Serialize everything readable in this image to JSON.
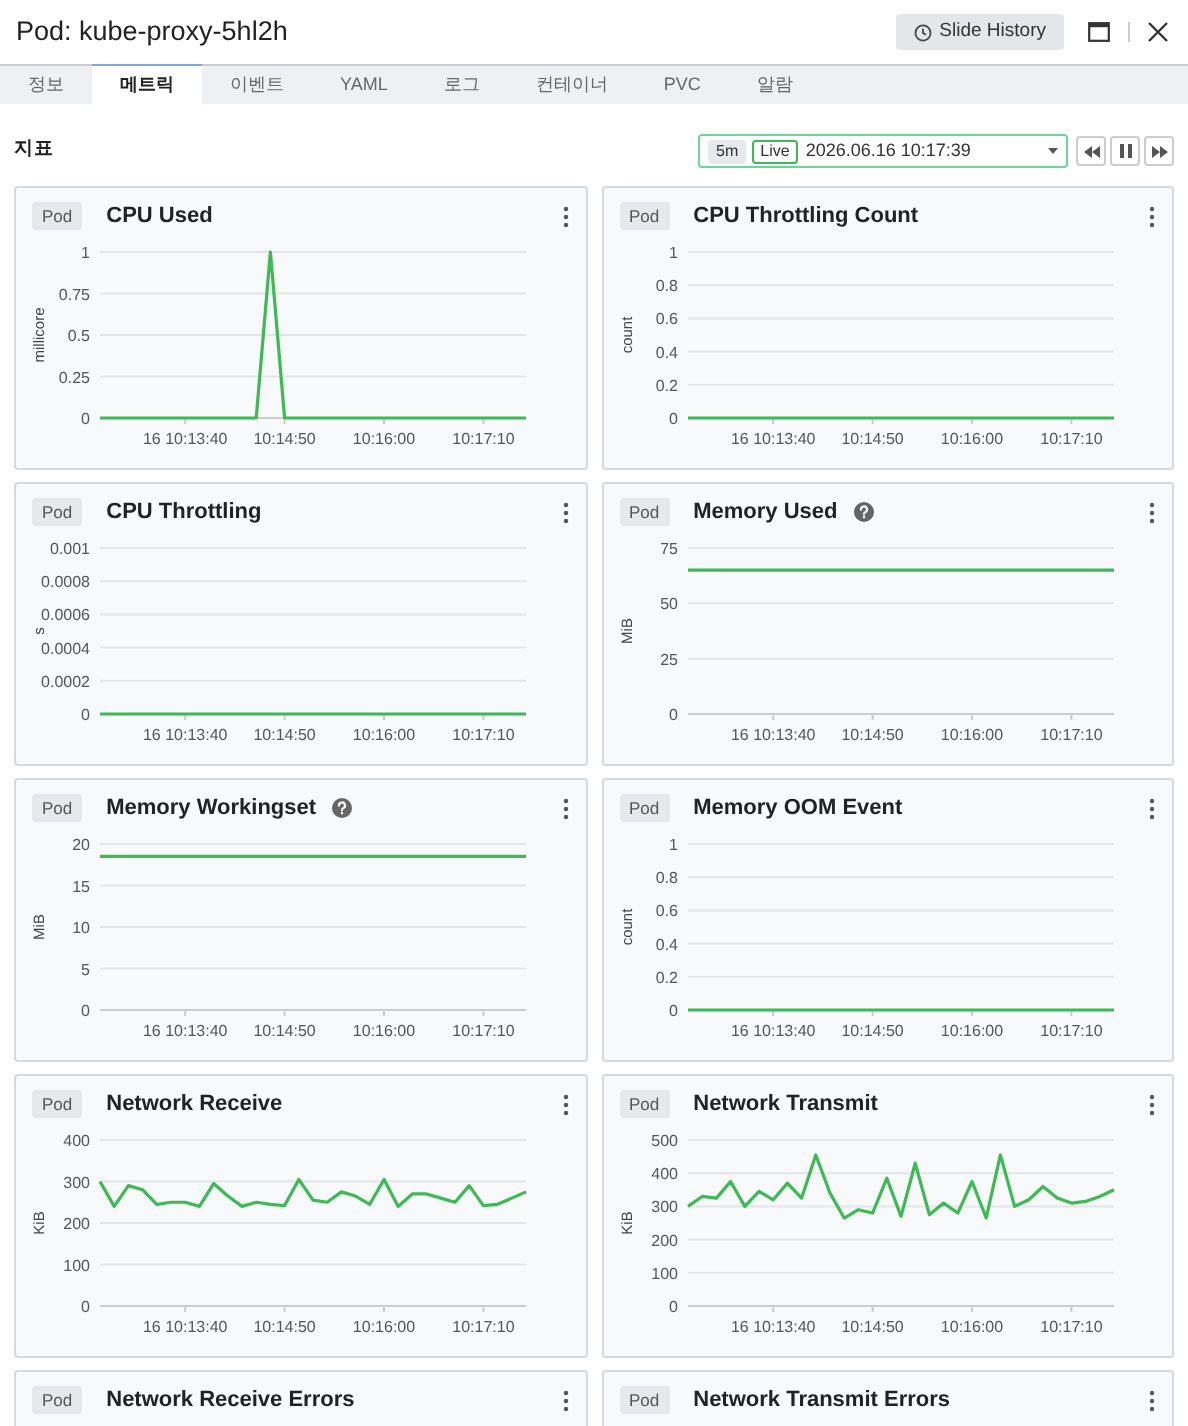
{
  "window": {
    "title": "Pod: kube-proxy-5hl2h",
    "history_button": "Slide History"
  },
  "tabs": [
    {
      "label": "정보",
      "selected": false
    },
    {
      "label": "메트릭",
      "selected": true
    },
    {
      "label": "이벤트",
      "selected": false
    },
    {
      "label": "YAML",
      "selected": false
    },
    {
      "label": "로그",
      "selected": false
    },
    {
      "label": "컨테이너",
      "selected": false
    },
    {
      "label": "PVC",
      "selected": false
    },
    {
      "label": "알람",
      "selected": false
    }
  ],
  "section_title": "지표",
  "time_range": {
    "range": "5m",
    "live": "Live",
    "datetime": "2026.06.16 10:17:39"
  },
  "cards": [
    {
      "badge": "Pod",
      "title": "CPU Used",
      "help": false,
      "chart_data": {
        "type": "line",
        "ylabel": "millicore",
        "ylim": [
          0,
          1
        ],
        "yticks": [
          0,
          0.25,
          0.5,
          0.75,
          1
        ],
        "categories": [
          null,
          null,
          null,
          null,
          null,
          null,
          "16 10:13:40",
          null,
          null,
          null,
          null,
          null,
          null,
          "10:14:50",
          null,
          null,
          null,
          null,
          null,
          null,
          "10:16:00",
          null,
          null,
          null,
          null,
          null,
          null,
          "10:17:10",
          null,
          null,
          null
        ],
        "grid": true,
        "series": [
          {
            "color": "#3cba54",
            "values": [
              0,
              0,
              0,
              0,
              0,
              0,
              0,
              0,
              0,
              0,
              0,
              0,
              1,
              0,
              0,
              0,
              0,
              0,
              0,
              0,
              0,
              0,
              0,
              0,
              0,
              0,
              0,
              0,
              0,
              0,
              0
            ]
          }
        ]
      }
    },
    {
      "badge": "Pod",
      "title": "CPU Throttling Count",
      "help": false,
      "chart_data": {
        "type": "line",
        "ylabel": "count",
        "ylim": [
          0,
          1
        ],
        "yticks": [
          0,
          0.2,
          0.4,
          0.6,
          0.8,
          1
        ],
        "categories": [
          null,
          null,
          null,
          null,
          null,
          null,
          "16 10:13:40",
          null,
          null,
          null,
          null,
          null,
          null,
          "10:14:50",
          null,
          null,
          null,
          null,
          null,
          null,
          "10:16:00",
          null,
          null,
          null,
          null,
          null,
          null,
          "10:17:10",
          null,
          null,
          null
        ],
        "grid": true,
        "series": [
          {
            "color": "#3cba54",
            "values": [
              0,
              0,
              0,
              0,
              0,
              0,
              0,
              0,
              0,
              0,
              0,
              0,
              0,
              0,
              0,
              0,
              0,
              0,
              0,
              0,
              0,
              0,
              0,
              0,
              0,
              0,
              0,
              0,
              0,
              0,
              0
            ]
          }
        ]
      }
    },
    {
      "badge": "Pod",
      "title": "CPU Throttling",
      "help": false,
      "chart_data": {
        "type": "line",
        "ylabel": "s",
        "ylim": [
          0,
          0.001
        ],
        "yticks": [
          0,
          0.0002,
          0.0004,
          0.0006,
          0.0008,
          0.001
        ],
        "categories": [
          null,
          null,
          null,
          null,
          null,
          null,
          "16 10:13:40",
          null,
          null,
          null,
          null,
          null,
          null,
          "10:14:50",
          null,
          null,
          null,
          null,
          null,
          null,
          "10:16:00",
          null,
          null,
          null,
          null,
          null,
          null,
          "10:17:10",
          null,
          null,
          null
        ],
        "grid": true,
        "series": [
          {
            "color": "#3cba54",
            "values": [
              0,
              0,
              0,
              0,
              0,
              0,
              0,
              0,
              0,
              0,
              0,
              0,
              0,
              0,
              0,
              0,
              0,
              0,
              0,
              0,
              0,
              0,
              0,
              0,
              0,
              0,
              0,
              0,
              0,
              0,
              0
            ]
          }
        ]
      }
    },
    {
      "badge": "Pod",
      "title": "Memory Used",
      "help": true,
      "chart_data": {
        "type": "line",
        "ylabel": "MiB",
        "ylim": [
          0,
          75
        ],
        "yticks": [
          0,
          25,
          50,
          75
        ],
        "categories": [
          null,
          null,
          null,
          null,
          null,
          null,
          "16 10:13:40",
          null,
          null,
          null,
          null,
          null,
          null,
          "10:14:50",
          null,
          null,
          null,
          null,
          null,
          null,
          "10:16:00",
          null,
          null,
          null,
          null,
          null,
          null,
          "10:17:10",
          null,
          null,
          null
        ],
        "grid": true,
        "series": [
          {
            "color": "#3cba54",
            "values": [
              65,
              65,
              65,
              65,
              65,
              65,
              65,
              65,
              65,
              65,
              65,
              65,
              65,
              65,
              65,
              65,
              65,
              65,
              65,
              65,
              65,
              65,
              65,
              65,
              65,
              65,
              65,
              65,
              65,
              65,
              65
            ]
          }
        ]
      }
    },
    {
      "badge": "Pod",
      "title": "Memory Workingset",
      "help": true,
      "chart_data": {
        "type": "line",
        "ylabel": "MiB",
        "ylim": [
          0,
          20
        ],
        "yticks": [
          0,
          5,
          10,
          15,
          20
        ],
        "categories": [
          null,
          null,
          null,
          null,
          null,
          null,
          "16 10:13:40",
          null,
          null,
          null,
          null,
          null,
          null,
          "10:14:50",
          null,
          null,
          null,
          null,
          null,
          null,
          "10:16:00",
          null,
          null,
          null,
          null,
          null,
          null,
          "10:17:10",
          null,
          null,
          null
        ],
        "grid": true,
        "series": [
          {
            "color": "#3cba54",
            "values": [
              18.5,
              18.5,
              18.5,
              18.5,
              18.5,
              18.5,
              18.5,
              18.5,
              18.5,
              18.5,
              18.5,
              18.5,
              18.5,
              18.5,
              18.5,
              18.5,
              18.5,
              18.5,
              18.5,
              18.5,
              18.5,
              18.5,
              18.5,
              18.5,
              18.5,
              18.5,
              18.5,
              18.5,
              18.5,
              18.5,
              18.5
            ]
          }
        ]
      }
    },
    {
      "badge": "Pod",
      "title": "Memory OOM Event",
      "help": false,
      "chart_data": {
        "type": "line",
        "ylabel": "count",
        "ylim": [
          0,
          1
        ],
        "yticks": [
          0,
          0.2,
          0.4,
          0.6,
          0.8,
          1
        ],
        "categories": [
          null,
          null,
          null,
          null,
          null,
          null,
          "16 10:13:40",
          null,
          null,
          null,
          null,
          null,
          null,
          "10:14:50",
          null,
          null,
          null,
          null,
          null,
          null,
          "10:16:00",
          null,
          null,
          null,
          null,
          null,
          null,
          "10:17:10",
          null,
          null,
          null
        ],
        "grid": true,
        "series": [
          {
            "color": "#3cba54",
            "values": [
              0,
              0,
              0,
              0,
              0,
              0,
              0,
              0,
              0,
              0,
              0,
              0,
              0,
              0,
              0,
              0,
              0,
              0,
              0,
              0,
              0,
              0,
              0,
              0,
              0,
              0,
              0,
              0,
              0,
              0,
              0
            ]
          }
        ]
      }
    },
    {
      "badge": "Pod",
      "title": "Network Receive",
      "help": false,
      "chart_data": {
        "type": "line",
        "ylabel": "KiB",
        "ylim": [
          0,
          400
        ],
        "yticks": [
          0,
          100,
          200,
          300,
          400
        ],
        "categories": [
          null,
          null,
          null,
          null,
          null,
          null,
          "16 10:13:40",
          null,
          null,
          null,
          null,
          null,
          null,
          "10:14:50",
          null,
          null,
          null,
          null,
          null,
          null,
          "10:16:00",
          null,
          null,
          null,
          null,
          null,
          null,
          "10:17:10",
          null,
          null,
          null
        ],
        "grid": true,
        "series": [
          {
            "color": "#3cba54",
            "values": [
              300,
              240,
              290,
              280,
              245,
              250,
              250,
              240,
              295,
              265,
              240,
              250,
              245,
              242,
              305,
              255,
              250,
              275,
              265,
              245,
              305,
              240,
              270,
              270,
              260,
              250,
              290,
              242,
              245,
              260,
              275
            ]
          }
        ]
      }
    },
    {
      "badge": "Pod",
      "title": "Network Transmit",
      "help": false,
      "chart_data": {
        "type": "line",
        "ylabel": "KiB",
        "ylim": [
          0,
          500
        ],
        "yticks": [
          0,
          100,
          200,
          300,
          400,
          500
        ],
        "categories": [
          null,
          null,
          null,
          null,
          null,
          null,
          "16 10:13:40",
          null,
          null,
          null,
          null,
          null,
          null,
          "10:14:50",
          null,
          null,
          null,
          null,
          null,
          null,
          "10:16:00",
          null,
          null,
          null,
          null,
          null,
          null,
          "10:17:10",
          null,
          null,
          null
        ],
        "grid": true,
        "series": [
          {
            "color": "#3cba54",
            "values": [
              300,
              330,
              325,
              375,
              300,
              345,
              320,
              370,
              325,
              455,
              340,
              265,
              290,
              280,
              385,
              270,
              430,
              275,
              310,
              280,
              375,
              265,
              455,
              300,
              320,
              360,
              325,
              310,
              315,
              330,
              350
            ]
          }
        ]
      }
    },
    {
      "badge": "Pod",
      "title": "Network Receive Errors",
      "help": false
    },
    {
      "badge": "Pod",
      "title": "Network Transmit Errors",
      "help": false
    }
  ]
}
